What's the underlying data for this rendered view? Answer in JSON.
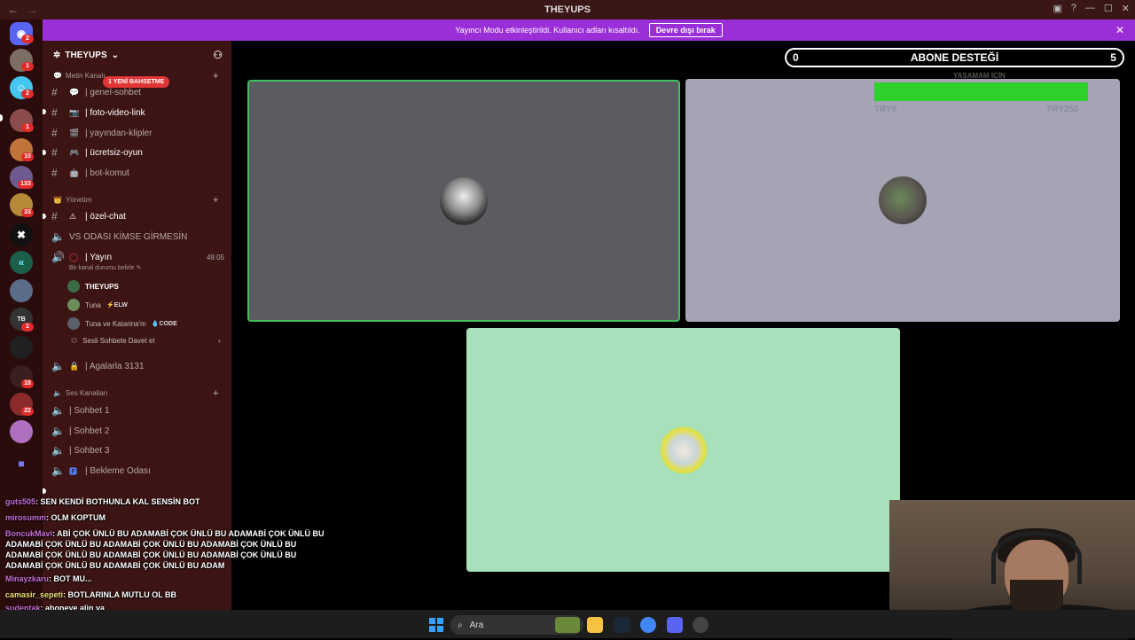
{
  "window": {
    "title": "THEYUPS",
    "back": "←",
    "forward": "→"
  },
  "titlebar_icons": [
    "inbox-icon",
    "help-icon",
    "minimize-icon",
    "maximize-icon",
    "close-icon"
  ],
  "banner": {
    "text": "Yayıncı Modu etkinleştirildi. Kullanıcı adları kısaltıldı.",
    "button": "Devre dışı bırak"
  },
  "server_rail": {
    "badges": [
      "2",
      "1",
      "2",
      "1",
      "10",
      "133",
      "33",
      "1",
      "18",
      "22"
    ]
  },
  "guild": {
    "name": "THEYUPS"
  },
  "mention_pill": "1 YENİ BAHSETME",
  "categories": {
    "text": "Metin Kanalı",
    "admin": "Yönetim",
    "voice": "Ses Kanalları"
  },
  "text_channels": [
    {
      "name": "| genel-sohbet"
    },
    {
      "name": "| foto-video-link"
    },
    {
      "name": "| yayından-klipler"
    },
    {
      "name": "| ücretsiz-oyun"
    },
    {
      "name": "| bot-komut"
    }
  ],
  "admin_channels": [
    {
      "name": "| özel-chat"
    },
    {
      "name": "VS ODASI KİMSE GİRMESİN"
    }
  ],
  "live_channel": {
    "name": "| Yayın",
    "timer": "49:05",
    "status": "Bir kanal durumu belirle"
  },
  "voice_users": [
    {
      "name": "THEYUPS",
      "tag": ""
    },
    {
      "name": "Tuna",
      "tag": "ELW"
    },
    {
      "name": "Tuna ve Katarina'm",
      "tag": "CODE"
    }
  ],
  "invite_voice": "Sesli Sohbete Davet et",
  "locked_channel": "| Agalarla 3131",
  "voice_channels": [
    {
      "name": "| Sohbet 1"
    },
    {
      "name": "| Sohbet 2"
    },
    {
      "name": "| Sohbet 3"
    },
    {
      "name": "| Bekleme Odası"
    }
  ],
  "goal": {
    "title": "ABONE DESTEĞİ",
    "current": "0",
    "target": "5",
    "caption": "YAŞAMAM İÇİN",
    "min": "TRY0",
    "max": "TRY250",
    "progress": 1.0
  },
  "chat": [
    {
      "user": "guts505",
      "text": ": SEN KENDİ BOTHUNLA KAL SENSİN BOT"
    },
    {
      "user": "mirosumm",
      "text": ": OLM KOPTUM"
    },
    {
      "user": "BoncukMavi",
      "text": ": ABİ ÇOK ÜNLÜ BU ADAMABİ ÇOK ÜNLÜ BU ADAMABİ ÇOK ÜNLÜ BU ADAMABİ ÇOK ÜNLÜ BU ADAMABİ ÇOK ÜNLÜ BU ADAMABİ ÇOK ÜNLÜ BU ADAMABİ ÇOK ÜNLÜ BU ADAMABİ ÇOK ÜNLÜ BU ADAMABİ ÇOK ÜNLÜ BU ADAMABİ ÇOK ÜNLÜ BU ADAMABİ ÇOK ÜNLÜ BU ADAM"
    },
    {
      "user": "Minayzkaru",
      "text": ": BOT MU..."
    },
    {
      "user": "camasir_sepeti",
      "text": ": BOTLARINLA MUTLU OL BB"
    },
    {
      "user": "sudentak",
      "text": ": aboneye alin ya"
    }
  ],
  "taskbar": {
    "search_placeholder": "Ara"
  },
  "colors": {
    "banner": "#9a2fd8",
    "goal_bar": "#2ed12b",
    "tile_active": "#5a5c62",
    "tile_2": "#a4a4b4",
    "tile_3": "#a7e0bb"
  }
}
